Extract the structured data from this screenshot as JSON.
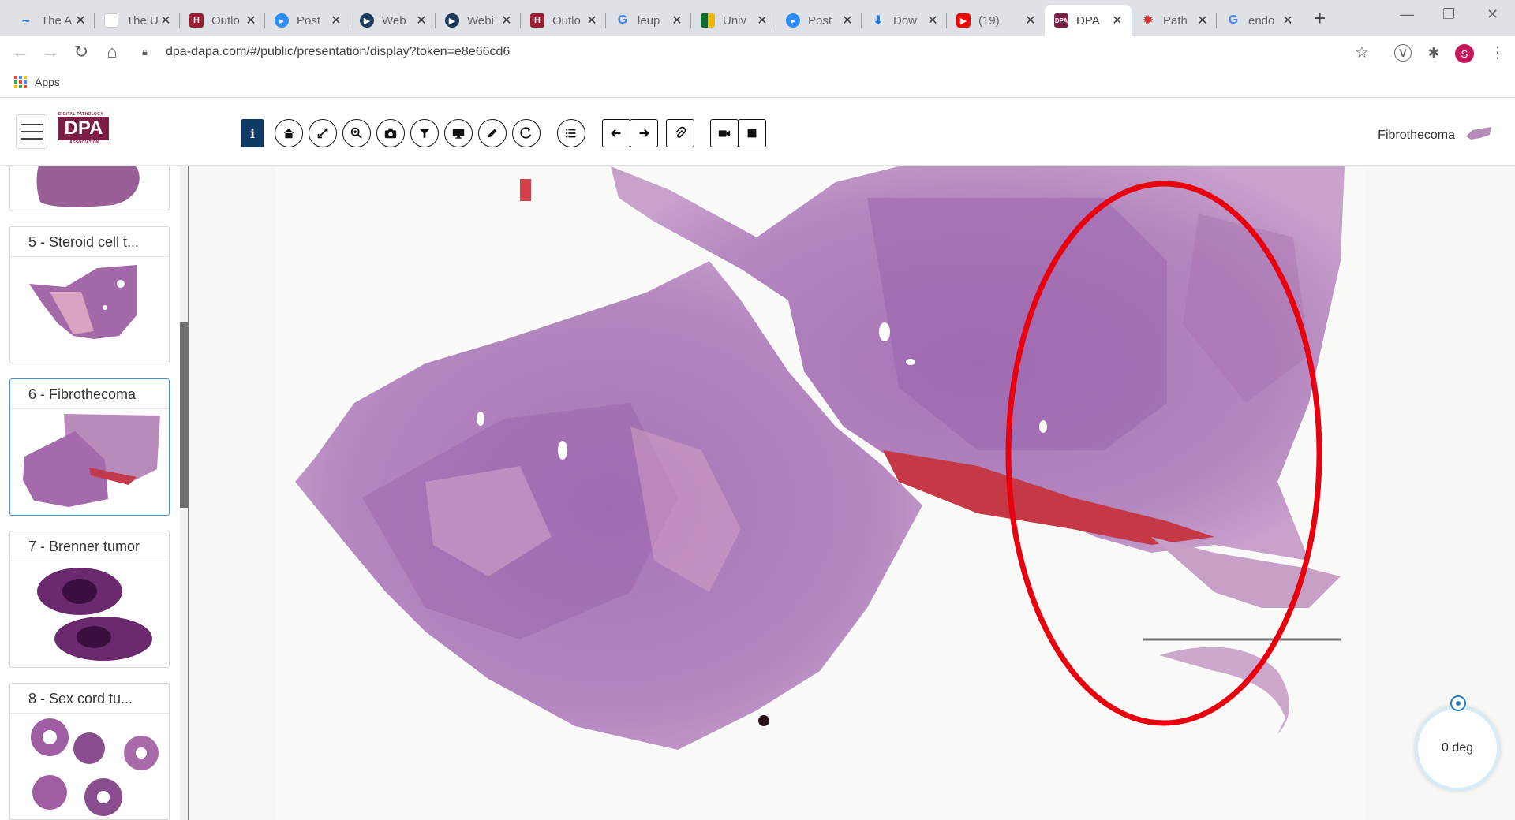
{
  "browser": {
    "tabs": [
      {
        "title": "The A",
        "favicon": "loop-icon"
      },
      {
        "title": "The U",
        "favicon": "blank-page-icon"
      },
      {
        "title": "Outlo",
        "favicon": "hsc-icon"
      },
      {
        "title": "Post",
        "favicon": "zoom-icon"
      },
      {
        "title": "Web",
        "favicon": "webex-icon"
      },
      {
        "title": "Webi",
        "favicon": "webex-icon"
      },
      {
        "title": "Outlo",
        "favicon": "hsc-icon"
      },
      {
        "title": "leup",
        "favicon": "google-icon"
      },
      {
        "title": "Univ",
        "favicon": "univ-icon"
      },
      {
        "title": "Post",
        "favicon": "zoom-icon"
      },
      {
        "title": "Dow",
        "favicon": "download-icon"
      },
      {
        "title": "(19)",
        "favicon": "youtube-icon"
      },
      {
        "title": "DPA",
        "favicon": "dpa-icon",
        "active": true
      },
      {
        "title": "Path",
        "favicon": "gear-red-icon"
      },
      {
        "title": "endo",
        "favicon": "google-icon"
      }
    ],
    "new_tab": "+",
    "url": "dpa-dapa.com/#/public/presentation/display?token=e8e66cd6",
    "profile_initial": "S",
    "bookmarks_apps": "Apps"
  },
  "app": {
    "logo_small": "DIGITAL PATHOLOGY",
    "logo_main": "DPA",
    "logo_sub": "ASSOCIATION",
    "info_label": "i",
    "slide_title": "Fibrothecoma",
    "toolbar_icons": [
      "home-icon",
      "fullscreen-icon",
      "zoom-icon",
      "camera-icon",
      "filter-icon",
      "monitor-icon",
      "pencil-icon",
      "rotate-icon",
      "list-icon",
      "arrow-left-icon",
      "arrow-right-icon",
      "attachment-icon",
      "video-icon",
      "stop-icon"
    ]
  },
  "sidebar": {
    "slides": [
      {
        "label": "",
        "partial": true
      },
      {
        "label": "5 - Steroid cell t..."
      },
      {
        "label": "6 - Fibrothecoma",
        "active": true
      },
      {
        "label": "7 - Brenner tumor"
      },
      {
        "label": "8 - Sex cord tu..."
      }
    ]
  },
  "viewer": {
    "rotation": "0 deg",
    "annotation_color": "#e8000f",
    "tissue_color": "#a070b4"
  }
}
